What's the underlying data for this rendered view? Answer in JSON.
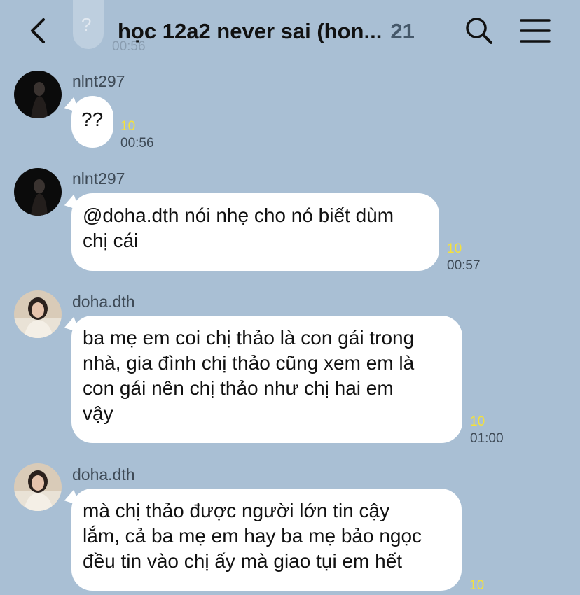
{
  "header": {
    "title": "học 12a2 never sai (hon...",
    "member_count": "21",
    "ghost_bubble_text": "?",
    "ghost_time": "00:56",
    "back_icon": "chevron-left-icon",
    "search_icon": "search-icon",
    "menu_icon": "hamburger-menu-icon"
  },
  "colors": {
    "background": "#a9bfd4",
    "bubble": "#ffffff",
    "read_count": "#f5e13a",
    "meta_text": "#3e4a56"
  },
  "messages": [
    {
      "sender": "nlnt297",
      "text": "??",
      "read_count": "10",
      "time": "00:56"
    },
    {
      "sender": "nlnt297",
      "text_lines": [
        "@doha.dth nói nhẹ cho nó biết dùm",
        "chị cái"
      ],
      "read_count": "10",
      "time": "00:57"
    },
    {
      "sender": "doha.dth",
      "text_lines": [
        "ba mẹ em coi chị thảo là con gái trong",
        "nhà, gia đình chị thảo cũng xem em là",
        "con gái nên chị thảo như chị hai em",
        "vậy"
      ],
      "read_count": "10",
      "time": "01:00"
    },
    {
      "sender": "doha.dth",
      "text_lines": [
        "mà chị thảo được người lớn tin cậy",
        "lắm, cả ba mẹ em hay ba mẹ bảo ngọc",
        "đều tin vào chị ấy mà giao tụi em hết"
      ],
      "read_count": "10"
    }
  ]
}
